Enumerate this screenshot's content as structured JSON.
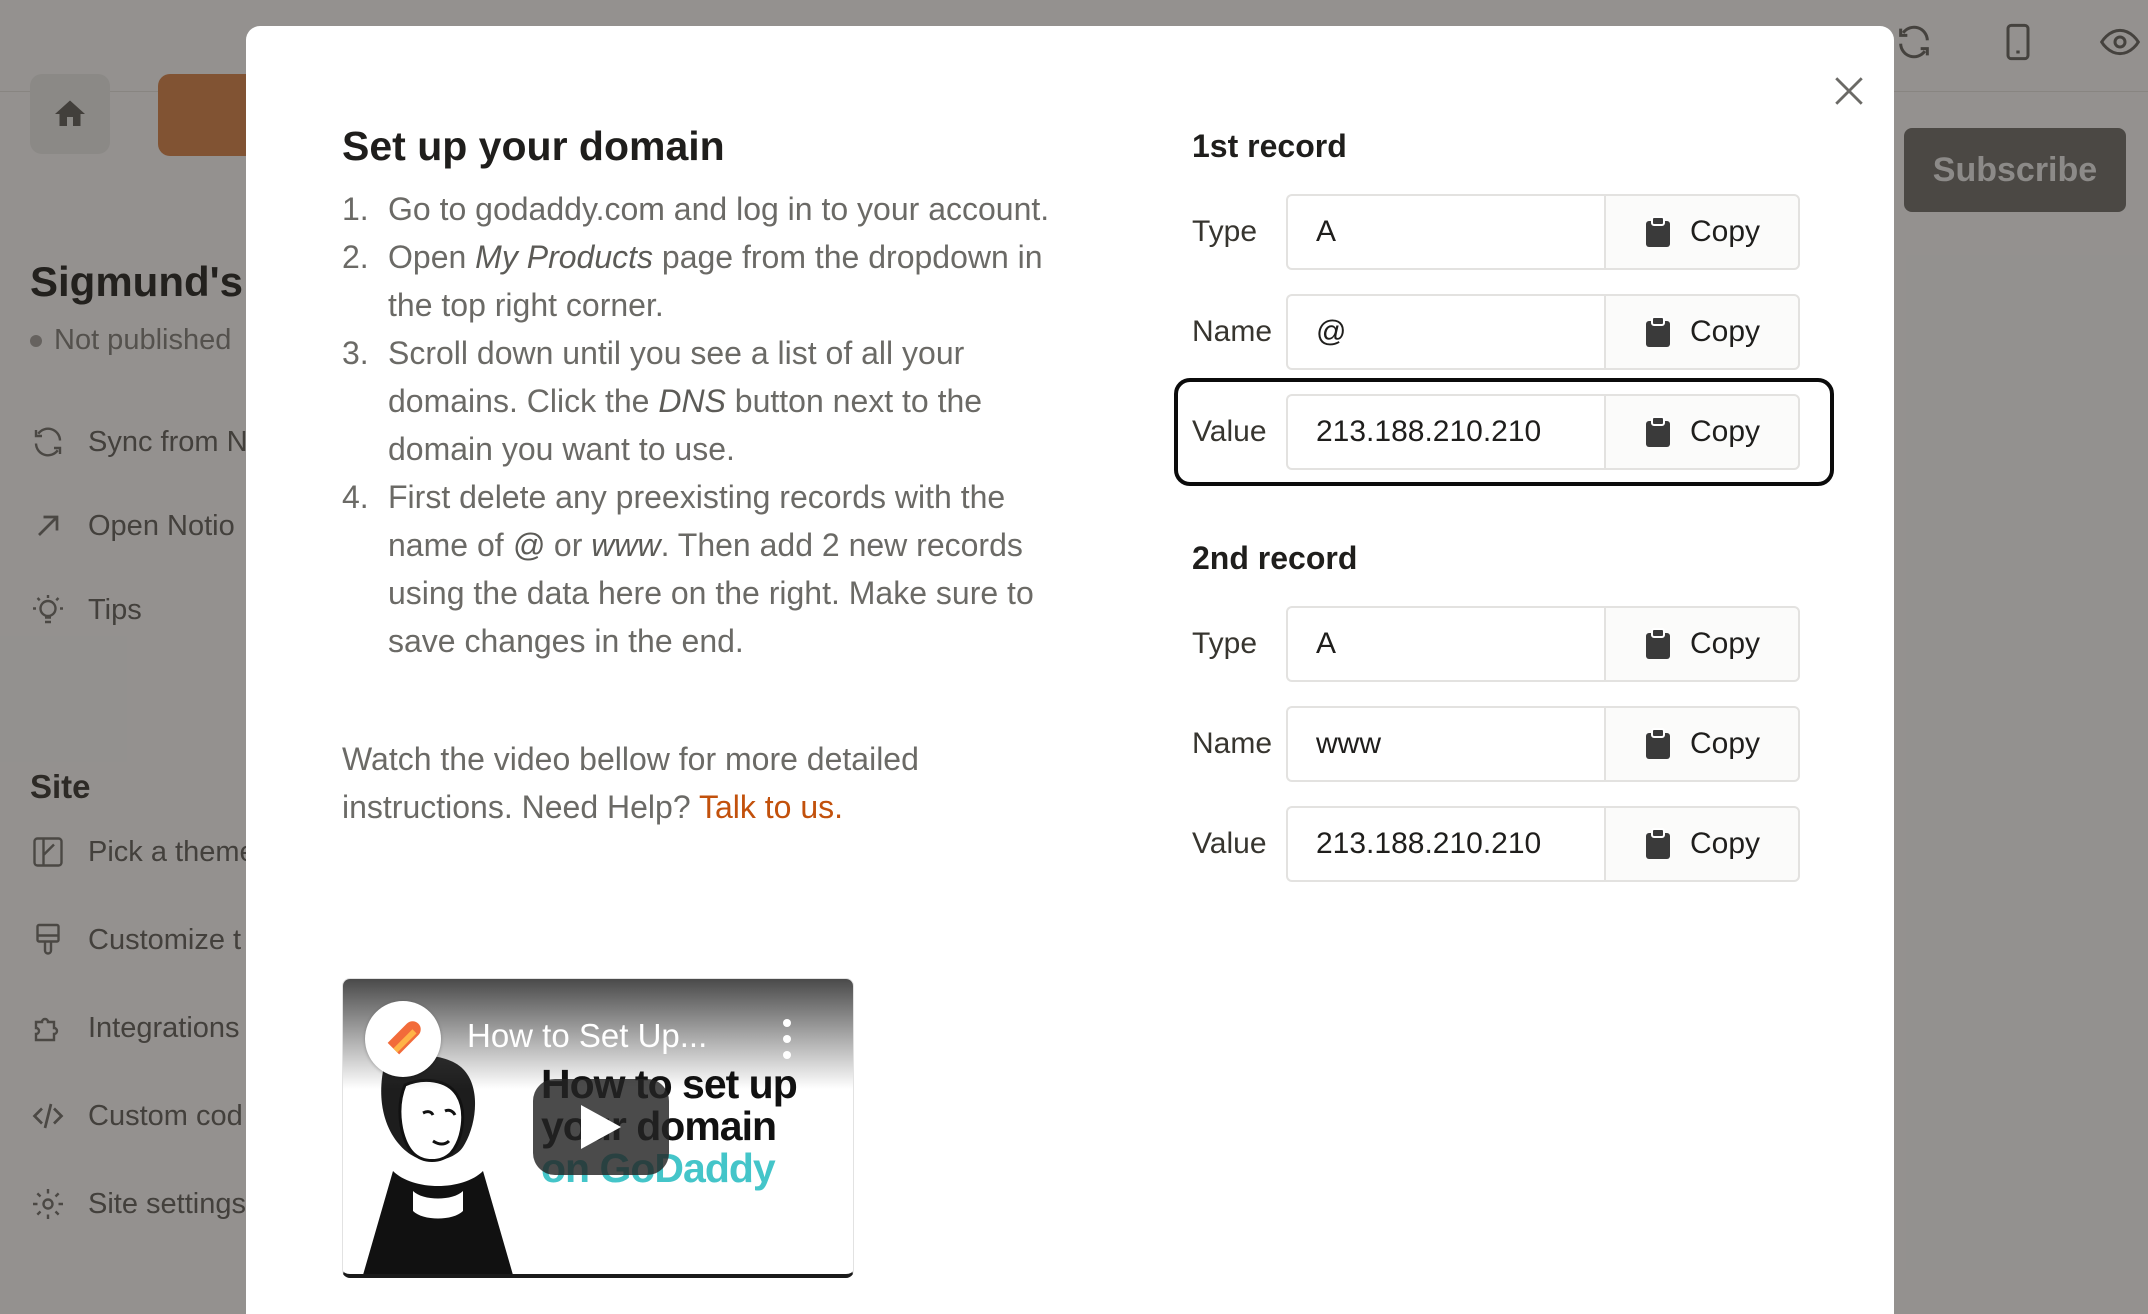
{
  "background": {
    "subscribe_label": "Subscribe",
    "site_title": "Sigmund's",
    "site_status": "Not published",
    "sidebar_items": [
      {
        "label": "Sync from N",
        "icon": "sync-icon"
      },
      {
        "label": "Open Notio",
        "icon": "arrow-up-right-icon"
      },
      {
        "label": "Tips",
        "icon": "lightbulb-icon"
      }
    ],
    "site_section": "Site",
    "site_items": [
      {
        "label": "Pick a theme",
        "icon": "theme-icon"
      },
      {
        "label": "Customize t",
        "icon": "brush-icon"
      },
      {
        "label": "Integrations",
        "icon": "puzzle-icon"
      },
      {
        "label": "Custom cod",
        "icon": "code-icon"
      },
      {
        "label": "Site settings",
        "icon": "gear-icon"
      }
    ]
  },
  "modal": {
    "title": "Set up your domain",
    "steps": [
      {
        "num": "1.",
        "parts": [
          {
            "t": "Go to godaddy.com and log in to your account."
          }
        ]
      },
      {
        "num": "2.",
        "parts": [
          {
            "t": "Open "
          },
          {
            "t": "My Products",
            "em": true
          },
          {
            "t": " page from the dropdown in the top right corner."
          }
        ]
      },
      {
        "num": "3.",
        "parts": [
          {
            "t": "Scroll down until you see a list of all your domains. Click the "
          },
          {
            "t": "DNS",
            "em": true
          },
          {
            "t": " button next to the domain you want to use."
          }
        ]
      },
      {
        "num": "4.",
        "parts": [
          {
            "t": "First delete any preexisting records with the name of "
          },
          {
            "t": "@",
            "em": true
          },
          {
            "t": " or "
          },
          {
            "t": "www",
            "em": true
          },
          {
            "t": ". Then add 2 new records using the data here on the right. Make sure to save changes in the end."
          }
        ]
      }
    ],
    "watch_text": "Watch the video bellow for more detailed instructions. Need Help?",
    "talk_link": "Talk to us.",
    "video": {
      "title": "How to Set Up...",
      "headline_1": "How to set up",
      "headline_2": "your domain",
      "headline_3": "on GoDaddy"
    },
    "records": {
      "first_heading": "1st record",
      "second_heading": "2nd record",
      "copy_label": "Copy",
      "first": [
        {
          "label": "Type",
          "value": "A"
        },
        {
          "label": "Name",
          "value": "@"
        },
        {
          "label": "Value",
          "value": "213.188.210.210"
        }
      ],
      "second": [
        {
          "label": "Type",
          "value": "A"
        },
        {
          "label": "Name",
          "value": "www"
        },
        {
          "label": "Value",
          "value": "213.188.210.210"
        }
      ]
    }
  }
}
